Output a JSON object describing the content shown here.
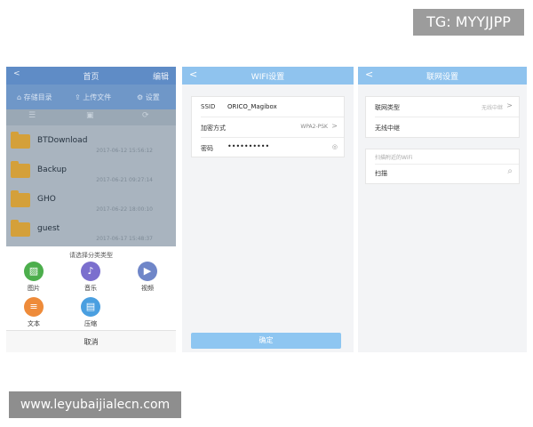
{
  "overlays": {
    "tg": "TG: MYYJJPP",
    "watermark": "www.leyubaijialecn.com"
  },
  "panel1": {
    "header": {
      "back": "<",
      "title": "首页",
      "edit": "编辑"
    },
    "toolbar": [
      {
        "label": "存储目录"
      },
      {
        "label": "上传文件"
      },
      {
        "label": "设置"
      }
    ],
    "controls": [
      "☰",
      "▣",
      "⟳"
    ],
    "folders": [
      {
        "name": "BTDownload",
        "date": "2017-06-12 15:56:12"
      },
      {
        "name": "Backup",
        "date": "2017-06-21 09:27:14"
      },
      {
        "name": "GHO",
        "date": "2017-06-22 18:00:10"
      },
      {
        "name": "guest",
        "date": "2017-06-17 15:48:37"
      }
    ],
    "sheet_title": "请选择分类类型",
    "categories": [
      {
        "label": "图片",
        "color": "#4cae4c",
        "icon": "image-icon",
        "glyph": "▨"
      },
      {
        "label": "音乐",
        "color": "#7b6fce",
        "icon": "music-icon",
        "glyph": "♪"
      },
      {
        "label": "视频",
        "color": "#6f86c8",
        "icon": "video-icon",
        "glyph": "▶"
      },
      {
        "label": "文本",
        "color": "#ee8b3a",
        "icon": "document-icon",
        "glyph": "≡"
      },
      {
        "label": "压缩",
        "color": "#4a9fe0",
        "icon": "archive-icon",
        "glyph": "▤"
      }
    ],
    "cancel": "取消"
  },
  "panel2": {
    "title": "WIFI设置",
    "back": "<",
    "ssid_label": "SSID",
    "ssid_value": "ORICO_Magibox",
    "encryption_label": "加密方式",
    "encryption_value": "WPA2-PSK",
    "password_label": "密码",
    "password_value": "••••••••••",
    "confirm": "确定"
  },
  "panel3": {
    "title": "联网设置",
    "back": "<",
    "network_type_label": "联网类型",
    "network_type_value": "无线中继",
    "wireless_relay": "无线中继",
    "scanned_label": "扫描附近的WiFi",
    "scan": "扫描"
  },
  "colors": {
    "accent": "#8fc3ee",
    "folder": "#d4a03a",
    "header_dark": "#5f8cc6"
  }
}
